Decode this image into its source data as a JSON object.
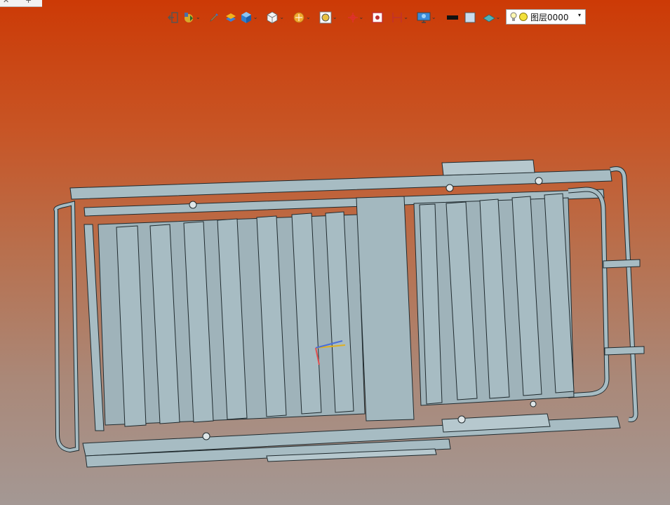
{
  "tabs": {
    "close_glyph": "✕",
    "new_tab_glyph": "+"
  },
  "toolbar": {
    "buttons": [
      {
        "name": "exit-icon",
        "dropdown": false
      },
      {
        "name": "move-object-icon",
        "dropdown": true
      },
      {
        "name": "pen-icon",
        "dropdown": false
      },
      {
        "name": "material-icon",
        "dropdown": false
      },
      {
        "name": "blue-cube-icon",
        "dropdown": true
      },
      {
        "name": "white-cube-icon",
        "dropdown": true
      },
      {
        "name": "shading-icon",
        "dropdown": true
      },
      {
        "name": "render-mode-icon",
        "dropdown": true
      },
      {
        "name": "snap-icon",
        "dropdown": true
      },
      {
        "name": "select-filter-icon",
        "dropdown": false
      },
      {
        "name": "dimension-icon",
        "dropdown": true
      },
      {
        "name": "display-icon",
        "dropdown": true
      },
      {
        "name": "line-color-icon",
        "dropdown": false
      },
      {
        "name": "fill-color-icon",
        "dropdown": false
      },
      {
        "name": "layer-manager-icon",
        "dropdown": true
      }
    ],
    "dropdown_glyph": "⌄"
  },
  "layer": {
    "label": "图层0000",
    "arrow": "▾",
    "bulb_icon": "light-bulb-icon",
    "color": "#f3e13a"
  },
  "viewport": {
    "background_top": "#cc3a06",
    "background_bottom": "#a49894",
    "model_color": "#9fb7bf",
    "edge_color": "#1f2a2e"
  }
}
